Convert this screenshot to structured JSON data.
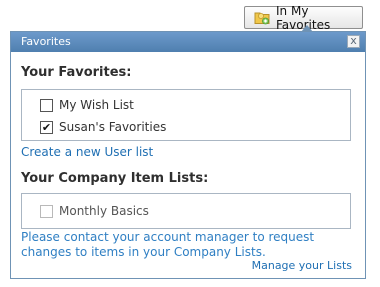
{
  "button": {
    "label": "In My Favorites",
    "icon": "favorites-folder-icon"
  },
  "popup": {
    "title": "Favorites",
    "close_label": "x",
    "your_favorites": {
      "heading": "Your Favorites:",
      "items": [
        {
          "label": "My Wish List",
          "checked": false
        },
        {
          "label": "Susan's Favorities",
          "checked": true
        }
      ],
      "create_link": "Create a new User list"
    },
    "company_lists": {
      "heading": "Your Company Item Lists:",
      "items": [
        {
          "label": "Monthly Basics",
          "checked": false,
          "disabled": true
        }
      ],
      "notice": "Please contact your account manager to request changes to items in your Company Lists.",
      "manage_link": "Manage your Lists"
    }
  },
  "colors": {
    "header_bg": "#5a88b9",
    "link": "#1f6fb3",
    "notice": "#2f7fc3"
  }
}
